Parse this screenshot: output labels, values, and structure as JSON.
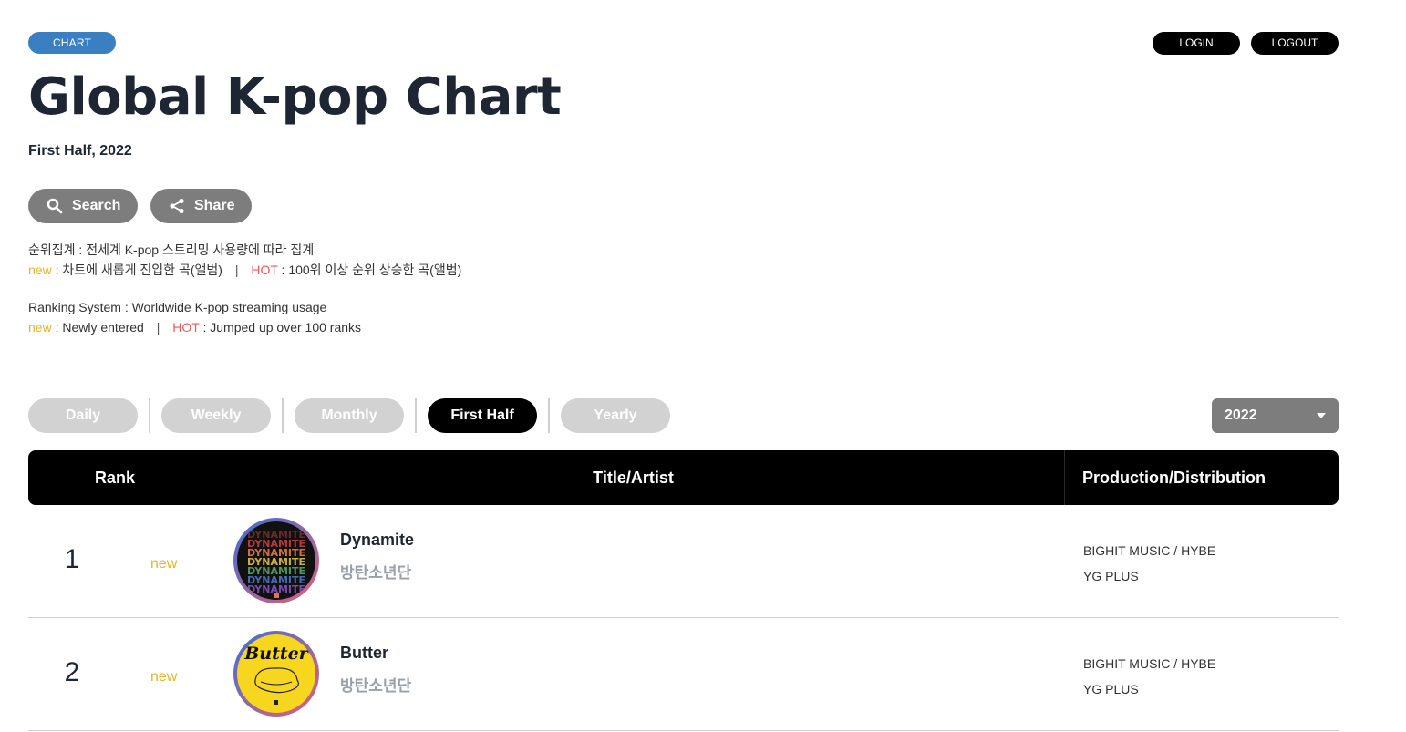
{
  "badge": "CHART",
  "auth": {
    "login": "LOGIN",
    "logout": "LOGOUT"
  },
  "title": "Global K-pop Chart",
  "subtitle": "First Half, 2022",
  "actions": {
    "search": "Search",
    "share": "Share"
  },
  "legend_ko": {
    "line1": "순위집계 : 전세계 K-pop 스트리밍 사용량에 따라 집계",
    "new_word": "new",
    "new_desc": " : 차트에 새롭게 진입한 곡(앨범)",
    "separator": "|",
    "hot_word": "HOT",
    "hot_desc": " : 100위 이상 순위 상승한 곡(앨범)"
  },
  "legend_en": {
    "line1": "Ranking System : Worldwide K-pop streaming usage",
    "new_word": "new",
    "new_desc": " : Newly entered",
    "separator": "|",
    "hot_word": "HOT",
    "hot_desc": " : Jumped up over 100 ranks"
  },
  "tabs": [
    "Daily",
    "Weekly",
    "Monthly",
    "First Half",
    "Yearly"
  ],
  "active_tab": "First Half",
  "year_select": "2022",
  "table_headers": {
    "rank": "Rank",
    "title_artist": "Title/Artist",
    "production": "Production/Distribution"
  },
  "rows": [
    {
      "rank": "1",
      "badge": "new",
      "title": "Dynamite",
      "artist": "방탄소년단",
      "production": "BIGHIT MUSIC / HYBE",
      "distribution": "YG PLUS",
      "cover_text": "DYNAMITE"
    },
    {
      "rank": "2",
      "badge": "new",
      "title": "Butter",
      "artist": "방탄소년단",
      "production": "BIGHIT MUSIC / HYBE",
      "distribution": "YG PLUS",
      "cover_text": "Butter"
    }
  ],
  "colors": {
    "badge": "#3a7fc1",
    "new": "#e3b52a",
    "hot": "#e45b5b",
    "header_bg": "#000000",
    "inactive_tab": "#d2d2d2",
    "button_gray": "#7d7d7d"
  }
}
